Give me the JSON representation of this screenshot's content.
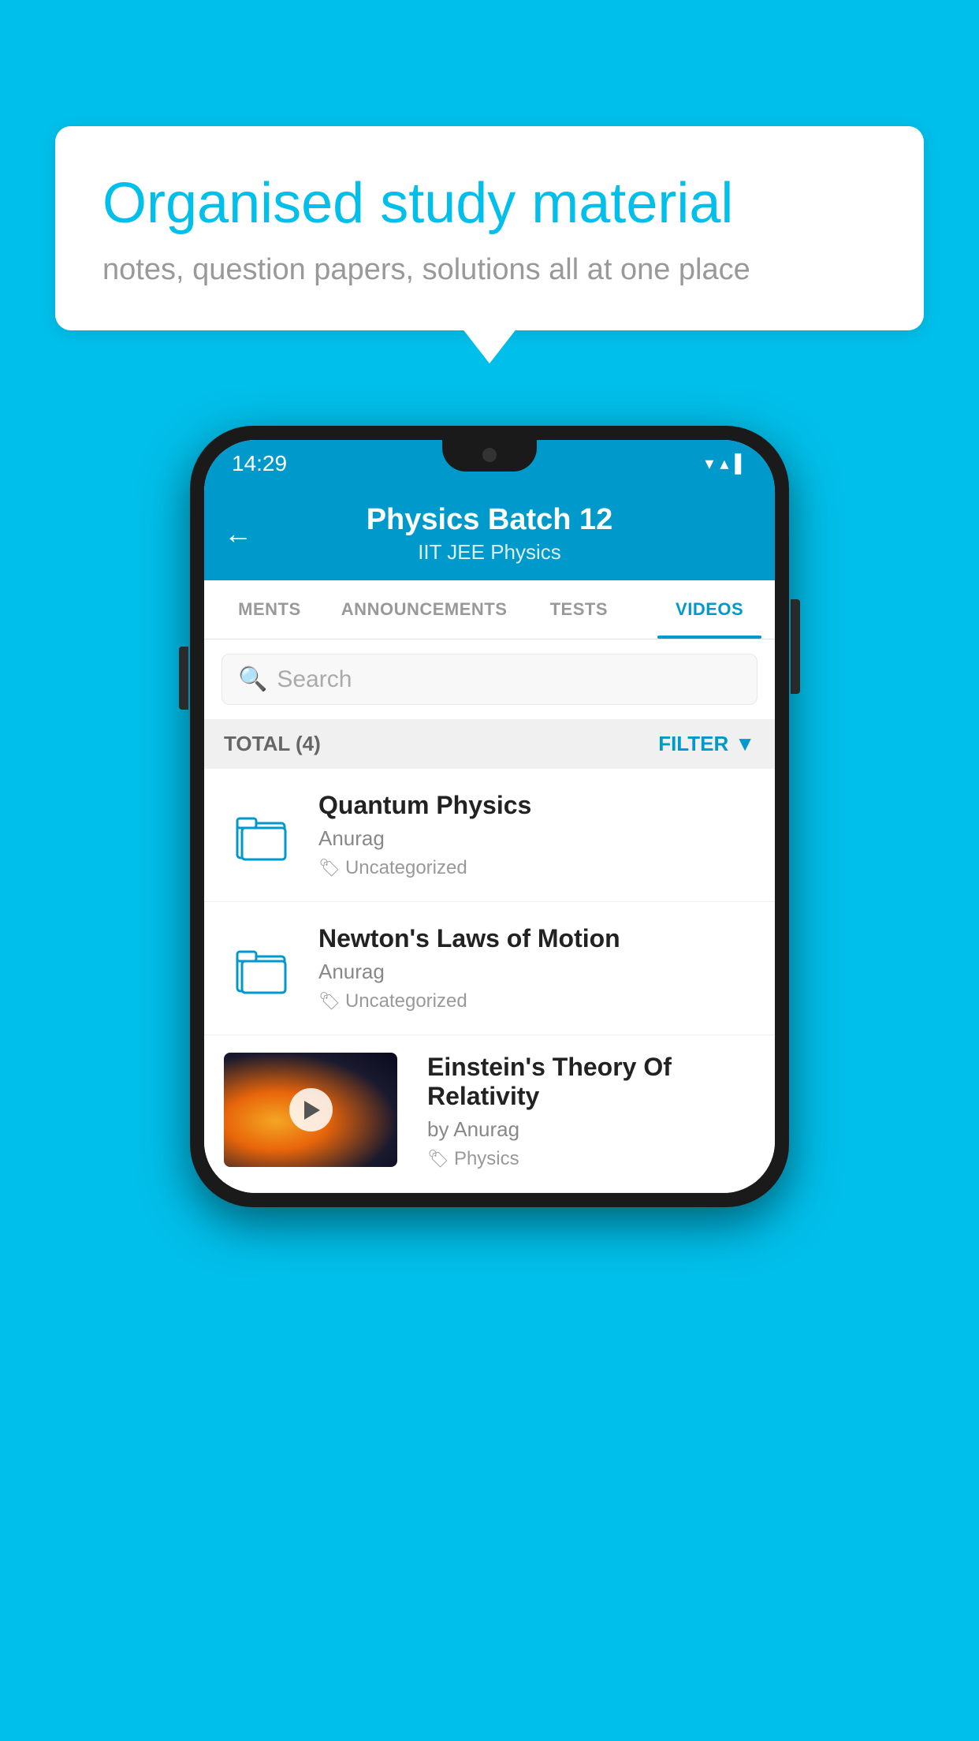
{
  "background_color": "#00BFEA",
  "speech_bubble": {
    "title": "Organised study material",
    "subtitle": "notes, question papers, solutions all at one place"
  },
  "phone": {
    "status_bar": {
      "time": "14:29",
      "icons": "▾ ▴ ▌"
    },
    "header": {
      "title": "Physics Batch 12",
      "subtitle": "IIT JEE   Physics",
      "back_label": "←"
    },
    "tabs": [
      {
        "label": "MENTS",
        "active": false
      },
      {
        "label": "ANNOUNCEMENTS",
        "active": false
      },
      {
        "label": "TESTS",
        "active": false
      },
      {
        "label": "VIDEOS",
        "active": true
      }
    ],
    "search": {
      "placeholder": "Search"
    },
    "filter_bar": {
      "total": "TOTAL (4)",
      "filter_label": "FILTER"
    },
    "videos": [
      {
        "id": 1,
        "title": "Quantum Physics",
        "author": "Anurag",
        "tag": "Uncategorized",
        "type": "folder"
      },
      {
        "id": 2,
        "title": "Newton's Laws of Motion",
        "author": "Anurag",
        "tag": "Uncategorized",
        "type": "folder"
      },
      {
        "id": 3,
        "title": "Einstein's Theory Of Relativity",
        "author": "by Anurag",
        "tag": "Physics",
        "type": "video"
      }
    ]
  }
}
